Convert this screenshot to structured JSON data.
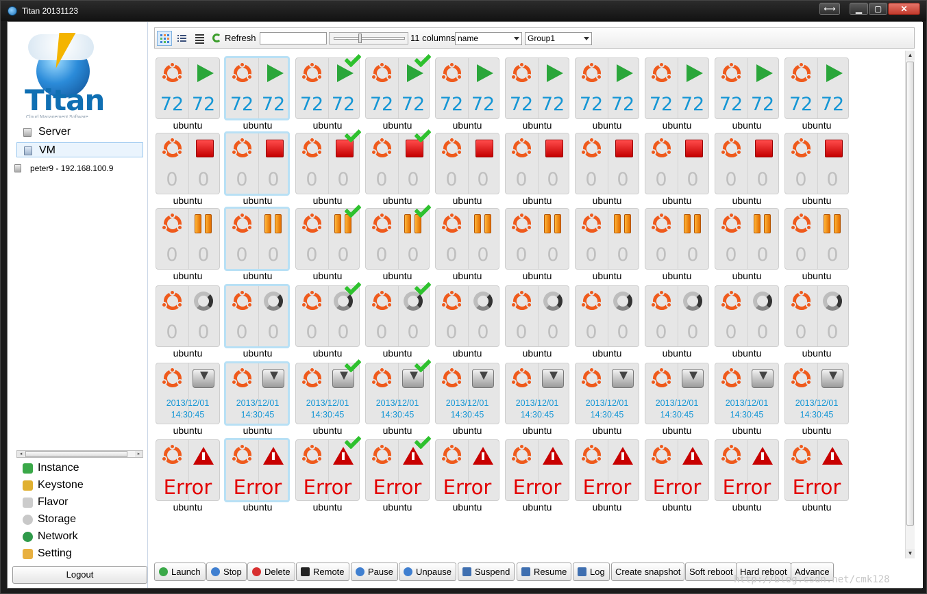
{
  "window": {
    "title": "Titan 20131123"
  },
  "logo": {
    "text": "Titan",
    "subtitle": "Cloud Management Software"
  },
  "tree": {
    "items": [
      {
        "label": "Server",
        "selected": false
      },
      {
        "label": "VM",
        "selected": true
      }
    ],
    "host": "peter9 - 192.168.100.9"
  },
  "menu": {
    "items": [
      {
        "label": "Instance",
        "icon": "puzzle-icon",
        "color": "#3aa848"
      },
      {
        "label": "Keystone",
        "icon": "key-icon",
        "color": "#e0b030"
      },
      {
        "label": "Flavor",
        "icon": "document-icon",
        "color": "#cccccc"
      },
      {
        "label": "Storage",
        "icon": "disk-icon",
        "color": "#c8c8c8"
      },
      {
        "label": "Network",
        "icon": "globe-icon",
        "color": "#2f9a4a"
      },
      {
        "label": "Setting",
        "icon": "pencil-icon",
        "color": "#e8b040"
      }
    ],
    "logout": "Logout"
  },
  "toolbar": {
    "refresh": "Refresh",
    "search_value": "",
    "columns_label": "11 columns",
    "sort_value": "name",
    "group_value": "Group1"
  },
  "grid": {
    "columns": 10,
    "vm_name": "ubuntu",
    "selected_column": 1,
    "checked_columns": [
      2,
      3
    ],
    "rows": [
      {
        "state": "running",
        "icon": "play-icon",
        "left": "72",
        "right": "72"
      },
      {
        "state": "stopped",
        "icon": "stop-icon",
        "left": "0",
        "right": "0"
      },
      {
        "state": "paused",
        "icon": "pause-icon",
        "left": "0",
        "right": "0"
      },
      {
        "state": "busy",
        "icon": "spinner-icon",
        "left": "0",
        "right": "0"
      },
      {
        "state": "suspended",
        "icon": "save-icon",
        "date": "2013/12/01",
        "time": "14:30:45"
      },
      {
        "state": "error",
        "icon": "warning-icon",
        "error": "Error"
      }
    ]
  },
  "actions": [
    {
      "label": "Launch",
      "icon": "plus-icon",
      "color": "#3aa848"
    },
    {
      "label": "Stop",
      "icon": "stop-circle-icon",
      "color": "#3f7fd0"
    },
    {
      "label": "Delete",
      "icon": "x-icon",
      "color": "#d83030"
    },
    {
      "label": "Remote",
      "icon": "terminal-icon",
      "color": "#222222"
    },
    {
      "label": "Pause",
      "icon": "pause-circle-icon",
      "color": "#3f7fd0"
    },
    {
      "label": "Unpause",
      "icon": "play-circle-icon",
      "color": "#3f7fd0"
    },
    {
      "label": "Suspend",
      "icon": "floppy-icon",
      "color": "#3f6fb0"
    },
    {
      "label": "Resume",
      "icon": "floppy-icon",
      "color": "#3f6fb0"
    },
    {
      "label": "Log",
      "icon": "log-icon",
      "color": "#3f6fb0"
    },
    {
      "label": "Create snapshot",
      "icon": "",
      "color": ""
    },
    {
      "label": "Soft reboot",
      "icon": "",
      "color": ""
    },
    {
      "label": "Hard reboot",
      "icon": "",
      "color": ""
    },
    {
      "label": "Advance",
      "icon": "",
      "color": ""
    }
  ],
  "watermark": "http://blog.csdn.net/cmk128"
}
